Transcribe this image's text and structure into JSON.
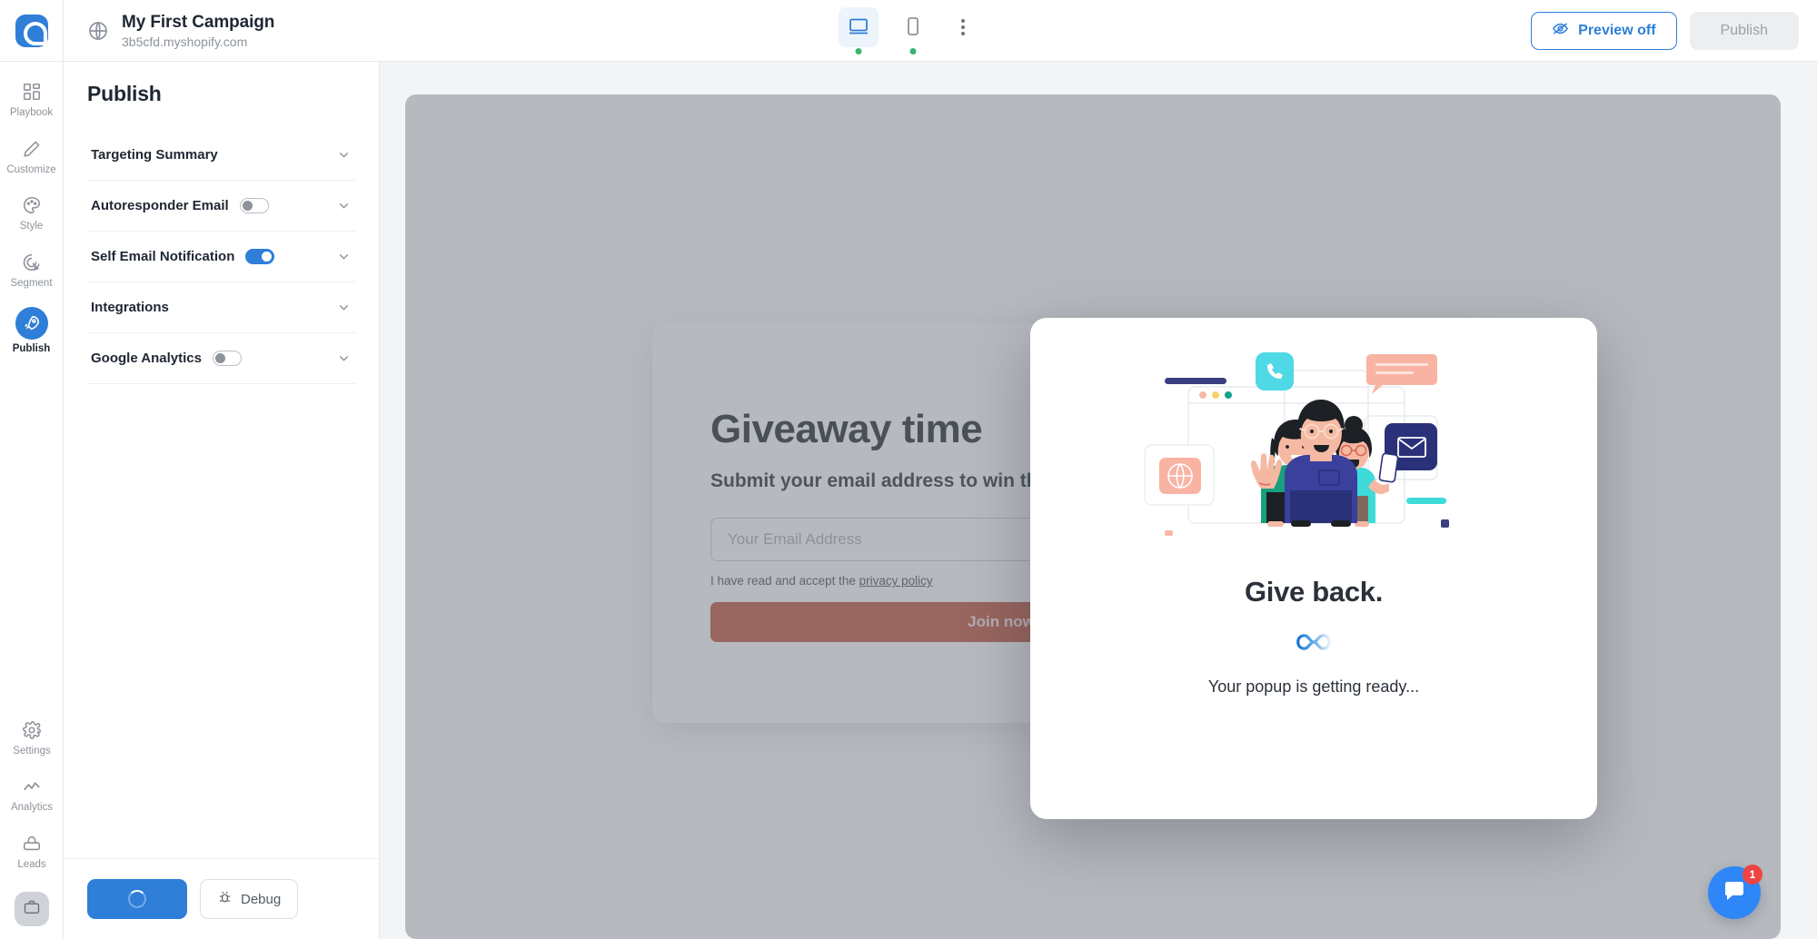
{
  "topbar": {
    "campaign_title": "My First Campaign",
    "campaign_url": "3b5cfd.myshopify.com",
    "desktop_icon": "desktop-icon",
    "mobile_icon": "mobile-icon",
    "more_icon": "kebab-menu-icon",
    "preview_label": "Preview off",
    "preview_icon": "eye-off-icon",
    "publish_label": "Publish"
  },
  "rail": {
    "top_items": [
      {
        "label": "Playbook",
        "icon": "grid-icon",
        "active": false
      },
      {
        "label": "Customize",
        "icon": "pencil-icon",
        "active": false
      },
      {
        "label": "Style",
        "icon": "palette-icon",
        "active": false
      },
      {
        "label": "Segment",
        "icon": "target-icon",
        "active": false
      },
      {
        "label": "Publish",
        "icon": "rocket-icon",
        "active": true
      }
    ],
    "bottom_items": [
      {
        "label": "Settings",
        "icon": "gear-icon"
      },
      {
        "label": "Analytics",
        "icon": "chart-line-icon"
      },
      {
        "label": "Leads",
        "icon": "leads-icon"
      }
    ],
    "avatar_icon": "briefcase-icon"
  },
  "panel": {
    "title": "Publish",
    "sections": [
      {
        "label": "Targeting Summary",
        "has_toggle": false,
        "toggle_on": false
      },
      {
        "label": "Autoresponder Email",
        "has_toggle": true,
        "toggle_on": false
      },
      {
        "label": "Self Email Notification",
        "has_toggle": true,
        "toggle_on": true
      },
      {
        "label": "Integrations",
        "has_toggle": false,
        "toggle_on": false
      },
      {
        "label": "Google Analytics",
        "has_toggle": true,
        "toggle_on": false
      }
    ],
    "primary_button_state": "loading",
    "debug_label": "Debug",
    "debug_icon": "bug-icon"
  },
  "popup_preview": {
    "close_icon": "close-icon",
    "heading": "Giveaway time",
    "subheading": "Submit your email address to win the mega giveaway!",
    "email_placeholder": "Your Email Address",
    "required_marker": "✻",
    "legal_prefix": "I have read and accept the ",
    "legal_link": "privacy policy",
    "cta_label": "Join now",
    "cta_color": "#c0513a"
  },
  "modal": {
    "illustration": "team-people-illustration",
    "heading": "Give back.",
    "loader_icon": "infinity-spinner-icon",
    "status_text": "Your popup is getting ready..."
  },
  "chat": {
    "icon": "chat-bubble-icon",
    "badge": "1",
    "badge_color": "#ef4444"
  },
  "colors": {
    "accent": "#2f7ed8",
    "status_green": "#3cb371",
    "scrim": "rgba(115,120,130,0.52)"
  }
}
